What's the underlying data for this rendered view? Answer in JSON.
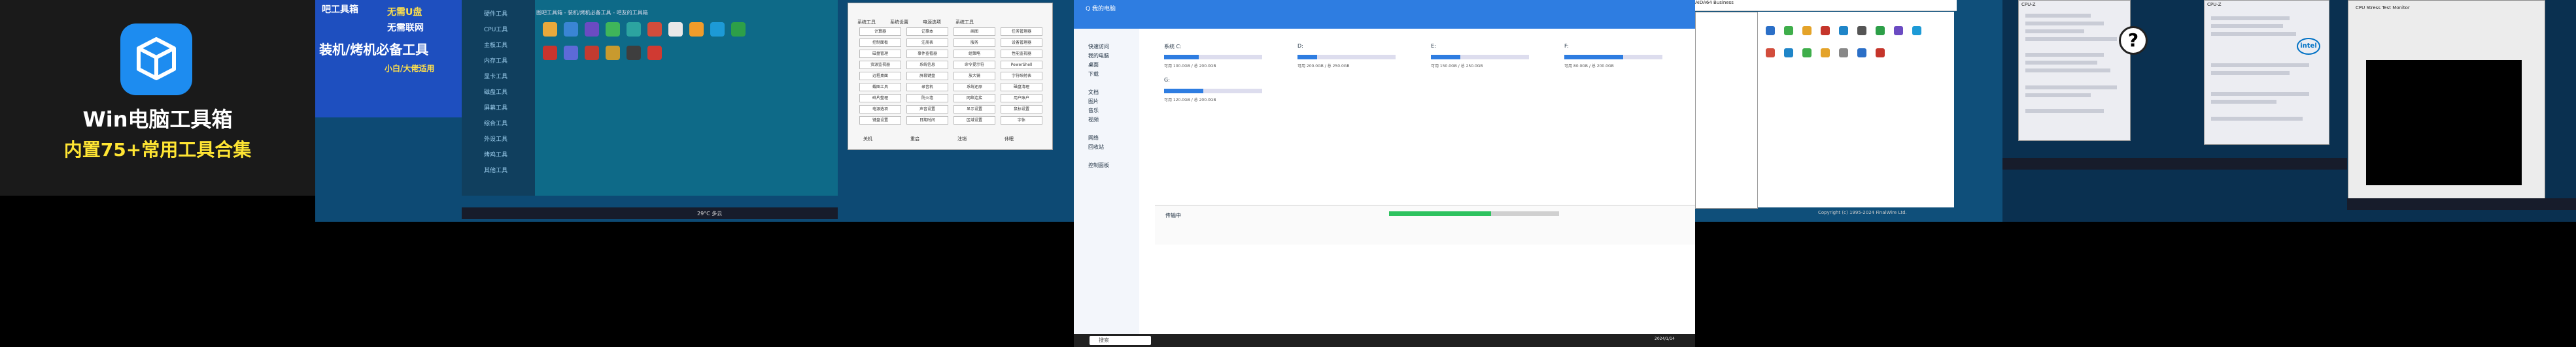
{
  "hero": {
    "title": "Win电脑工具箱",
    "subtitle": "内置75+常用工具合集",
    "icon": "box-icon"
  },
  "ad": {
    "line1": "无需U盘",
    "line2": "无需联网",
    "line3": "装机/烤机必备工具",
    "line4": "小白/大佬适用",
    "prefix": "吧工具箱"
  },
  "app1": {
    "title": "图吧工具箱 - 装机/烤机必备工具 - 吧友的工具箱",
    "sidebar": [
      "硬件工具",
      "CPU工具",
      "主板工具",
      "内存工具",
      "显卡工具",
      "磁盘工具",
      "屏幕工具",
      "综合工具",
      "外设工具",
      "烤鸡工具",
      "其他工具"
    ]
  },
  "dlg1": {
    "tabs": [
      "系统工具",
      "系统设置",
      "电源选项",
      "系统工具"
    ],
    "buttons": [
      "计算器",
      "记事本",
      "画图",
      "任务管理器",
      "控制面板",
      "注册表",
      "服务",
      "设备管理器",
      "磁盘管理",
      "事件查看器",
      "组策略",
      "性能监视器",
      "资源监视器",
      "系统信息",
      "命令提示符",
      "PowerShell",
      "远程桌面",
      "屏幕键盘",
      "放大镜",
      "字符映射表",
      "截图工具",
      "录音机",
      "系统还原",
      "磁盘清理",
      "碎片整理",
      "防火墙",
      "网络连接",
      "用户账户",
      "电源选项",
      "声音设置",
      "显示设置",
      "鼠标设置",
      "键盘设置",
      "日期时间",
      "区域设置",
      "字体"
    ],
    "footer": [
      "关机",
      "重启",
      "注销",
      "休眠"
    ]
  },
  "fm": {
    "title": "Q 我的电脑",
    "nav": [
      "快速访问",
      "我的电脑",
      "桌面",
      "下载",
      "文档",
      "图片",
      "音乐",
      "视频",
      "网络",
      "回收站",
      "控制面板"
    ],
    "drives": [
      {
        "label": "系统 C:",
        "fill": 0.35,
        "cap": "可用 100.0GB  /  总 200.0GB"
      },
      {
        "label": "D:",
        "fill": 0.2,
        "cap": "可用 200.0GB  /  总 250.0GB"
      },
      {
        "label": "E:",
        "fill": 0.3,
        "cap": "可用 150.0GB  /  总 250.0GB"
      },
      {
        "label": "F:",
        "fill": 0.6,
        "cap": "可用 80.0GB  /  总 200.0GB"
      },
      {
        "label": "G:",
        "fill": 0.4,
        "cap": "可用 120.0GB  /  总 200.0GB"
      }
    ],
    "bottom_label": "传输中",
    "progress": 0.6,
    "search": "搜索",
    "clock": "2024/1/14"
  },
  "aida": {
    "title": "AIDA64 Business",
    "footer": "Copyright (c) 1995-2024 FinalWire Ltd."
  },
  "cpuz": {
    "title1": "CPU-Z",
    "title2": "CPU-Z",
    "help": "?",
    "intel": "intel"
  },
  "monitor": {
    "title": "CPU Stress Test Monitor"
  },
  "weather": {
    "temp": "29°C 多云"
  }
}
